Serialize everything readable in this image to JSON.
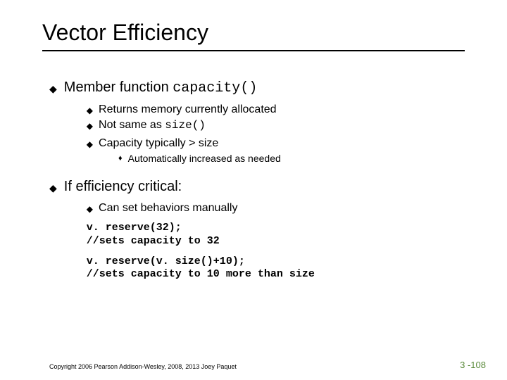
{
  "title": "Vector Efficiency",
  "bullets": {
    "b1": "Member function ",
    "b1_code": "capacity()",
    "b1_1": "Returns memory currently allocated",
    "b1_2a": "Not same as ",
    "b1_2b": "size()",
    "b1_3": "Capacity typically > size",
    "b1_3_1": "Automatically increased as needed",
    "b2": "If efficiency critical:",
    "b2_1": "Can set behaviors manually"
  },
  "code1": "v. reserve(32);\n//sets capacity to 32",
  "code2": "v. reserve(v. size()+10);\n//sets capacity to 10 more than size",
  "copyright": "Copyright 2006 Pearson Addison-Wesley, 2008, 2013 Joey Paquet",
  "pagenum": "3 -108"
}
